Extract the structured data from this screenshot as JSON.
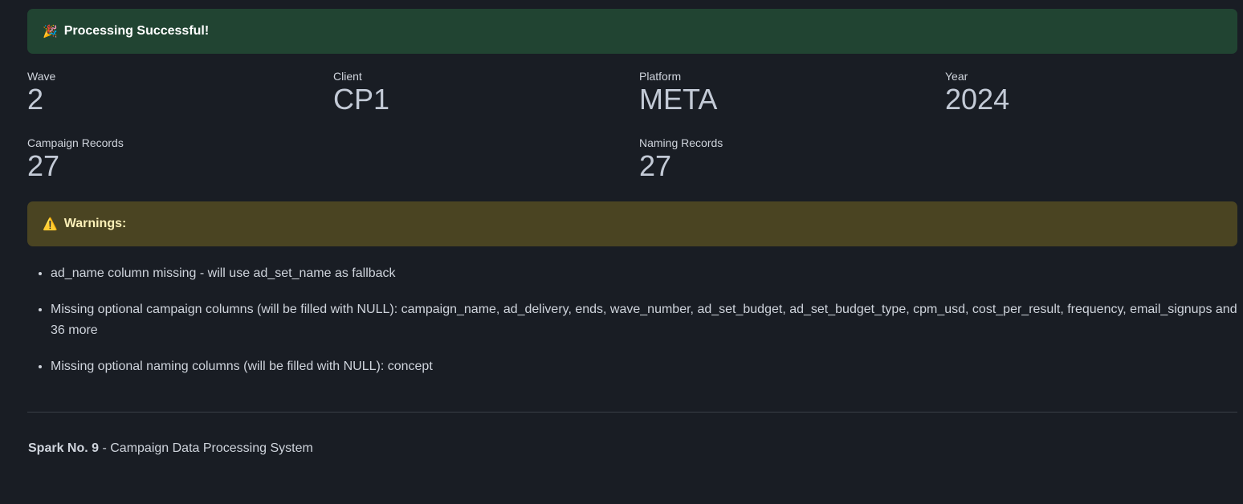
{
  "success_alert": {
    "icon": "party-popper-icon",
    "icon_glyph": "🎉",
    "text": "Processing Successful!"
  },
  "metrics": {
    "wave": {
      "label": "Wave",
      "value": "2"
    },
    "client": {
      "label": "Client",
      "value": "CP1"
    },
    "platform": {
      "label": "Platform",
      "value": "META"
    },
    "year": {
      "label": "Year",
      "value": "2024"
    },
    "campaign_records": {
      "label": "Campaign Records",
      "value": "27"
    },
    "naming_records": {
      "label": "Naming Records",
      "value": "27"
    }
  },
  "warning_alert": {
    "icon": "warning-triangle-icon",
    "icon_glyph": "⚠️",
    "text": "Warnings:"
  },
  "warnings": [
    "ad_name column missing - will use ad_set_name as fallback",
    "Missing optional campaign columns (will be filled with NULL): campaign_name, ad_delivery, ends, wave_number, ad_set_budget, ad_set_budget_type, cpm_usd, cost_per_result, frequency, email_signups and 36 more",
    "Missing optional naming columns (will be filled with NULL): concept"
  ],
  "footer": {
    "brand": "Spark No. 9",
    "tagline": " - Campaign Data Processing System"
  },
  "colors": {
    "background": "#191d24",
    "success_bg": "#214432",
    "warning_bg": "#4a4422"
  }
}
